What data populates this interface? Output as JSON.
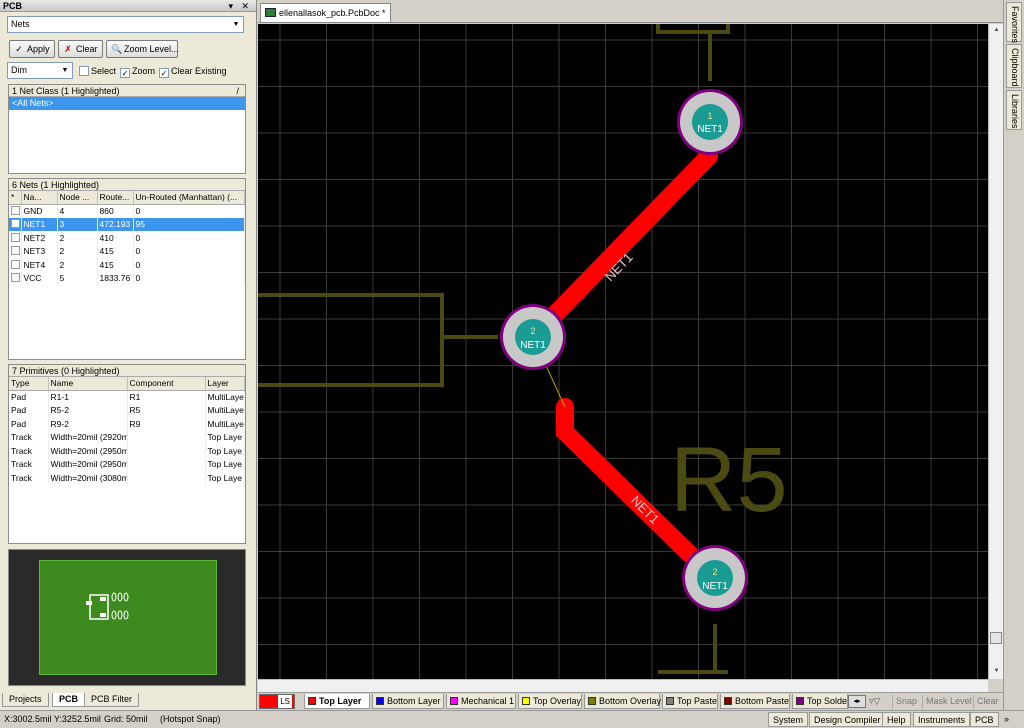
{
  "panel": {
    "title": "PCB",
    "controls": "▾ ✕",
    "mode_value": "Nets",
    "apply_label": "Apply",
    "clear_label": "Clear",
    "zoom_level_label": "Zoom Level...",
    "dim_value": "Dim",
    "select_label": "Select",
    "zoom_label": "Zoom",
    "clear_existing_label": "Clear Existing",
    "select_checked": "",
    "zoom_checked": "✓",
    "clear_existing_checked": "✓"
  },
  "net_class": {
    "header": "1 Net Class (1 Highlighted)",
    "sort_icon": "/",
    "items": [
      "<All Nets>"
    ]
  },
  "nets": {
    "header": "6 Nets (1 Highlighted)",
    "columns": [
      "*",
      "Na...",
      "Node ...",
      "Route...",
      "Un-Routed (Manhattan) (..."
    ],
    "rows": [
      {
        "name": "GND",
        "nodes": "4",
        "routed": "860",
        "unrouted": "0"
      },
      {
        "name": "NET1",
        "nodes": "3",
        "routed": "472.193",
        "unrouted": "95"
      },
      {
        "name": "NET2",
        "nodes": "2",
        "routed": "410",
        "unrouted": "0"
      },
      {
        "name": "NET3",
        "nodes": "2",
        "routed": "415",
        "unrouted": "0"
      },
      {
        "name": "NET4",
        "nodes": "2",
        "routed": "415",
        "unrouted": "0"
      },
      {
        "name": "VCC",
        "nodes": "5",
        "routed": "1833.76",
        "unrouted": "0"
      }
    ]
  },
  "primitives": {
    "header": "7 Primitives (0 Highlighted)",
    "columns": [
      "Type",
      "Name",
      "Component",
      "Layer"
    ],
    "rows": [
      {
        "type": "Pad",
        "name": "R1-1",
        "component": "R1",
        "layer": "MultiLaye"
      },
      {
        "type": "Pad",
        "name": "R5-2",
        "component": "R5",
        "layer": "MultiLaye"
      },
      {
        "type": "Pad",
        "name": "R9-2",
        "component": "R9",
        "layer": "MultiLaye"
      },
      {
        "type": "Track",
        "name": "Width=20mil (2920m",
        "component": "",
        "layer": "Top Laye"
      },
      {
        "type": "Track",
        "name": "Width=20mil (2950m",
        "component": "",
        "layer": "Top Laye"
      },
      {
        "type": "Track",
        "name": "Width=20mil (2950m",
        "component": "",
        "layer": "Top Laye"
      },
      {
        "type": "Track",
        "name": "Width=20mil (3080m",
        "component": "",
        "layer": "Top Laye"
      }
    ]
  },
  "bottom_tabs": [
    "Projects",
    "PCB",
    "PCB Filter"
  ],
  "document_tab": "ellenallasok_pcb.PcbDoc *",
  "right_tabs": [
    "Favorites",
    "Clipboard",
    "Libraries"
  ],
  "layers": {
    "ls_label": "LS",
    "tabs": [
      {
        "label": "Top Layer",
        "color": "#ff0000"
      },
      {
        "label": "Bottom Layer",
        "color": "#0000ff"
      },
      {
        "label": "Mechanical 1",
        "color": "#ff00ff"
      },
      {
        "label": "Top Overlay",
        "color": "#ffff00"
      },
      {
        "label": "Bottom Overlay",
        "color": "#808000"
      },
      {
        "label": "Top Paste",
        "color": "#808080"
      },
      {
        "label": "Bottom Paste",
        "color": "#800000"
      },
      {
        "label": "Top Solde",
        "color": "#800080"
      }
    ],
    "snap_label": "Snap",
    "mask_level_label": "Mask Level",
    "clear_label": "Clear"
  },
  "status": {
    "coords": "X:3002.5mil Y:3252.5mil",
    "grid": "Grid: 50mil",
    "snap_mode": "(Hotspot Snap)",
    "tabs": [
      "System",
      "Design Compiler",
      "Help",
      "Instruments",
      "PCB"
    ]
  },
  "pcb": {
    "pads": [
      {
        "number": "1",
        "net": "NET1"
      },
      {
        "number": "2",
        "net": "NET1"
      },
      {
        "number": "2",
        "net": "NET1"
      }
    ],
    "track_labels": [
      "NET1",
      "NET1"
    ],
    "designator": "R5",
    "colors": {
      "background": "#000000",
      "grid": "#3a3a3a",
      "track": "#ff0000",
      "overlay": "#4a4a12",
      "pad_ring": "#c8c8c8",
      "pad_center": "#1a9b93",
      "solder_ring": "#800080"
    }
  }
}
